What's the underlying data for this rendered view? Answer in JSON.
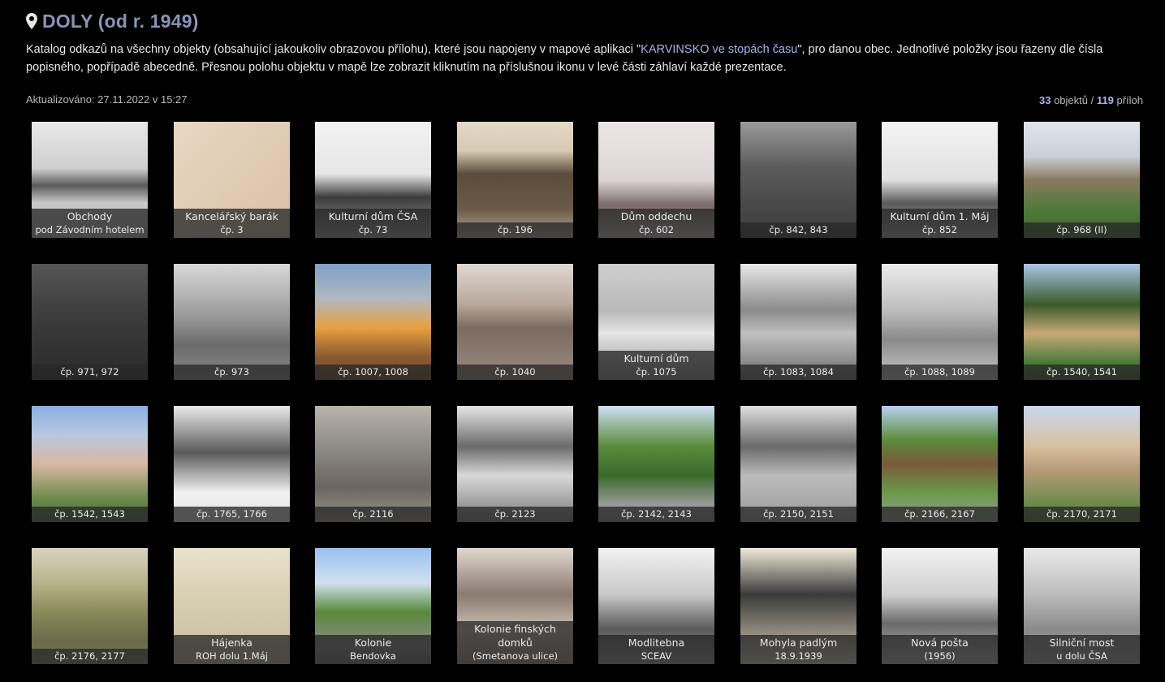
{
  "header": {
    "icon": "map-marker-icon",
    "title": "DOLY (od r. 1949)"
  },
  "description": {
    "text_before": "Katalog odkazů na všechny objekty (obsahující jakoukoliv obrazovou přílohu), které jsou napojeny v mapové aplikaci \"",
    "link_text": "KARVINSKO ve stopách času",
    "text_after": "\", pro danou obec. Jednotlivé položky jsou řazeny dle čísla popisného, popřípadě abecedně. Přesnou polohu objektu v mapě lze zobrazit kliknutím na příslušnou ikonu v levé části záhlaví každé prezentace."
  },
  "updated": "Aktualizováno: 27.11.2022 v 15:27",
  "counts": {
    "objects_value": "33",
    "objects_label": "objektů /",
    "attachments_value": "119",
    "attachments_label": "příloh"
  },
  "colors": {
    "accent": "#a9b4ee",
    "title": "#8a93b8"
  },
  "tiles": [
    {
      "l1": "Obchody",
      "l2": "pod Závodním hotelem",
      "bg": "linear-gradient(#e8e8e8 0%,#cfcfcf 40%,#5a5a5a 55%,#c9c9c9 70%,#bdbdbd 100%)"
    },
    {
      "l1": "Kancelářský barák",
      "l2": "čp. 3",
      "bg": "linear-gradient(135deg,#e9d7c2,#d9c0a6)"
    },
    {
      "l1": "Kulturní dům ČSA",
      "l2": "čp. 73",
      "bg": "linear-gradient(#f2f2f2 0%,#e6e6e6 45%,#3c3c3c 65%,#9a9a9a 100%)"
    },
    {
      "l1": "",
      "l2": "čp. 196",
      "bg": "linear-gradient(#e3d9c6 0%,#d6c9b1 25%,#5a4c3c 45%,#6a5a47 75%,#b8ab95 100%)"
    },
    {
      "l1": "Dům oddechu",
      "l2": "čp. 602",
      "bg": "linear-gradient(#ece6e6 0%,#ddd5d5 50%,#7a6a6a 72%,#c9bebe 100%)"
    },
    {
      "l1": "",
      "l2": "čp. 842, 843",
      "bg": "linear-gradient(#9a9a9a 0%,#5a5a5a 40%,#3a3a3a 100%)"
    },
    {
      "l1": "Kulturní dům 1. Máj",
      "l2": "čp. 852",
      "bg": "linear-gradient(#f4f4f4 0%,#e0e0e0 50%,#5a5a5a 70%,#a6a6a6 100%)"
    },
    {
      "l1": "",
      "l2": "čp. 968 (II)",
      "bg": "linear-gradient(#dfe6ee 0%,#c9cfd6 30%,#8a7a60 50%,#4f7a3a 75%,#3a6a2c 100%)"
    },
    {
      "l1": "",
      "l2": "čp. 971, 972",
      "bg": "linear-gradient(#555 0%,#3a3a3a 50%,#2a2a2a 100%)"
    },
    {
      "l1": "",
      "l2": "čp. 973",
      "bg": "linear-gradient(#d8d8d8 0%,#9a9a9a 45%,#6a6a6a 70%,#8a8a8a 100%)"
    },
    {
      "l1": "",
      "l2": "čp. 1007, 1008",
      "bg": "linear-gradient(#7fa0c8 0%,#b0b8c0 30%,#e8a040 55%,#8a5a30 80%,#6a4a2a 100%)"
    },
    {
      "l1": "",
      "l2": "čp. 1040",
      "bg": "linear-gradient(#e0d8d2 0%,#b8a89c 35%,#7a6a60 55%,#9a8a80 100%)"
    },
    {
      "l1": "Kulturní dům",
      "l2": "čp. 1075",
      "bg": "linear-gradient(#cfcfcf 0%,#b8b8b8 40%,#e6e6e6 60%,#8a8a8a 100%)"
    },
    {
      "l1": "",
      "l2": "čp. 1083, 1084",
      "bg": "linear-gradient(#e8e8e8 0%,#8a8a8a 40%,#c0c0c0 60%,#6a6a6a 100%)"
    },
    {
      "l1": "",
      "l2": "čp. 1088, 1089",
      "bg": "linear-gradient(#ececec 0%,#bdbdbd 40%,#8a8a8a 65%,#c8c8c8 100%)"
    },
    {
      "l1": "",
      "l2": "čp. 1540, 1541",
      "bg": "linear-gradient(#aac6e6 0%,#3a5a2a 35%,#c8a878 60%,#4a7a3a 85%,#3a5a2a 100%)"
    },
    {
      "l1": "",
      "l2": "čp. 1542, 1543",
      "bg": "linear-gradient(#8ab0e0 0%,#b8c8e0 25%,#d8b8a0 50%,#6a8a4a 80%,#4a6a3a 100%)"
    },
    {
      "l1": "",
      "l2": "čp. 1765, 1766",
      "bg": "linear-gradient(#eaeaea 0%,#5a5a5a 40%,#f2f2f2 75%,#e0e0e0 100%)"
    },
    {
      "l1": "",
      "l2": "čp. 2116",
      "bg": "linear-gradient(#b8b4ac 0%,#8a8680 40%,#6a665e 70%,#9a968e 100%)"
    },
    {
      "l1": "",
      "l2": "čp. 2123",
      "bg": "linear-gradient(#e6e6e6 0%,#6a6a6a 35%,#d8d8d8 60%,#7a7a7a 100%)"
    },
    {
      "l1": "",
      "l2": "čp. 2142, 2143",
      "bg": "linear-gradient(#cfe0f4 0%,#5a8a3a 35%,#3a6a2a 60%,#9a9a9a 85%,#8a8a8a 100%)"
    },
    {
      "l1": "",
      "l2": "čp. 2150, 2151",
      "bg": "linear-gradient(#e0e0e0 0%,#6a6a6a 35%,#bcbcbc 60%,#9a9a9a 100%)"
    },
    {
      "l1": "",
      "l2": "čp. 2166, 2167",
      "bg": "linear-gradient(#b8d0f0 0%,#5a8a3a 30%,#7a5a3a 50%,#6a9a4a 75%,#9a9a9a 100%)"
    },
    {
      "l1": "",
      "l2": "čp. 2170, 2171",
      "bg": "linear-gradient(#c8d8ec 0%,#d8c0a0 35%,#b89a78 55%,#6a8a4a 85%,#5a7a3a 100%)"
    },
    {
      "l1": "",
      "l2": "čp. 2176, 2177",
      "bg": "linear-gradient(#d8d4c0 0%,#b8b48a 30%,#8a8a5a 55%,#6a6a4a 80%,#7a7a5a 100%)"
    },
    {
      "l1": "Hájenka",
      "l2": "ROH dolu 1.Máj",
      "bg": "linear-gradient(#e8e2cc 0%,#d8d0b4 40%,#c8bc9c 100%)"
    },
    {
      "l1": "Kolonie",
      "l2": "Bendovka",
      "bg": "linear-gradient(#9ac0f0 0%,#d0e0f0 30%,#5a8a3a 55%,#8a8a8a 85%,#6a6a6a 100%)"
    },
    {
      "l1": "Kolonie finských domků",
      "l2": "(Smetanova ulice)",
      "bg": "linear-gradient(#e0d8d0 0%,#8a7a70 40%,#c8bcb0 70%,#9a8a80 100%)"
    },
    {
      "l1": "Modlitebna",
      "l2": "SCEAV",
      "bg": "linear-gradient(#f2f2f2 0%,#c8c8c8 40%,#5a5a5a 70%,#9a9a9a 100%)"
    },
    {
      "l1": "Mohyla padlým",
      "l2": "18.9.1939",
      "bg": "linear-gradient(#f0eada 0%,#3a3a3a 40%,#8a8478 70%,#d8d2c2 100%)"
    },
    {
      "l1": "Nová pošta",
      "l2": "(1956)",
      "bg": "linear-gradient(#f2f2f2 0%,#d0d0d0 40%,#6a6a6a 65%,#bcbcbc 100%)"
    },
    {
      "l1": "Silniční most",
      "l2": "u dolu ČSA",
      "bg": "linear-gradient(#eaeaea 0%,#bcbcbc 40%,#8a8a8a 70%,#a8a8a8 100%)"
    }
  ]
}
